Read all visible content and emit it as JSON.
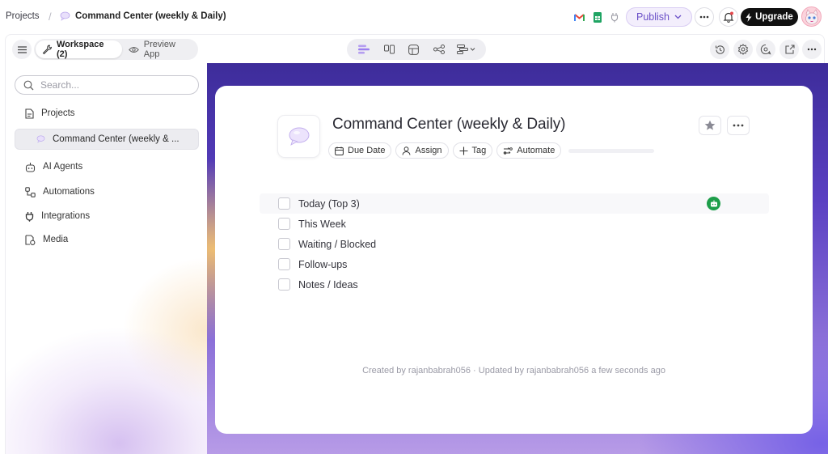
{
  "breadcrumb": {
    "root": "Projects",
    "separator": "/",
    "current": "Command Center (weekly & Daily)"
  },
  "topbar": {
    "apps": [
      "gmail-icon",
      "sheets-icon",
      "plug-icon"
    ],
    "publish_label": "Publish",
    "upgrade_label": "Upgrade",
    "notification_dot_color": "#e5484d"
  },
  "toolbar": {
    "workspace_label": "Workspace (2)",
    "preview_label": "Preview App",
    "views": [
      "list-view-icon",
      "board-view-icon",
      "table-view-icon",
      "graph-view-icon",
      "timeline-view-icon"
    ],
    "right_tools": [
      "history-icon",
      "settings-icon",
      "comment-search-icon",
      "share-icon",
      "more-icon"
    ]
  },
  "sidebar": {
    "search_placeholder": "Search...",
    "items": [
      {
        "label": "Projects",
        "icon": "file-icon"
      },
      {
        "label": "Command Center (weekly & ...",
        "icon": "chat-bubble-icon",
        "selected": true
      },
      {
        "label": "AI Agents",
        "icon": "robot-icon"
      },
      {
        "label": "Automations",
        "icon": "workflow-icon"
      },
      {
        "label": "Integrations",
        "icon": "plug-icon"
      },
      {
        "label": "Media",
        "icon": "media-icon"
      }
    ]
  },
  "page": {
    "title": "Command Center (weekly & Daily)",
    "chips": [
      {
        "label": "Due Date",
        "icon": "calendar-icon"
      },
      {
        "label": "Assign",
        "icon": "person-icon"
      },
      {
        "label": "Tag",
        "icon": "plus-icon"
      },
      {
        "label": "Automate",
        "icon": "automate-icon"
      }
    ],
    "items": [
      {
        "label": "Today (Top 3)",
        "checked": false,
        "badge": "robot-badge-icon"
      },
      {
        "label": "This Week",
        "checked": false
      },
      {
        "label": "Waiting / Blocked",
        "checked": false
      },
      {
        "label": "Follow-ups",
        "checked": false
      },
      {
        "label": "Notes / Ideas",
        "checked": false
      }
    ],
    "meta": "Created by rajanbabrah056 · Updated by rajanbabrah056 a few seconds ago"
  },
  "colors": {
    "accent": "#6a4fc8",
    "badge_green": "#1e9e4a"
  }
}
